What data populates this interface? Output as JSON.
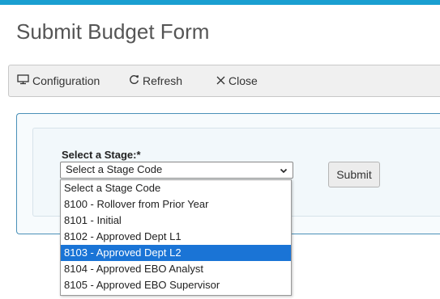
{
  "page": {
    "title": "Submit Budget Form"
  },
  "toolbar": {
    "configuration_label": "Configuration",
    "refresh_label": "Refresh",
    "close_label": "Close"
  },
  "form": {
    "stage_label": "Select a Stage:*",
    "select_value": "Select a Stage Code",
    "submit_label": "Submit"
  },
  "dropdown": {
    "options": [
      "Select a Stage Code",
      "8100 - Rollover from Prior Year",
      "8101 - Initial",
      "8102 - Approved Dept L1",
      "8103 - Approved Dept L2",
      "8104 - Approved EBO Analyst",
      "8105 - Approved EBO Supervisor"
    ],
    "highlighted": "8103 - Approved Dept L2"
  },
  "colors": {
    "accent_bar": "#1a9fd1",
    "panel_border": "#4a90b8",
    "highlight": "#1a74d6"
  },
  "icons": {
    "configuration": "monitor-icon",
    "refresh": "refresh-icon",
    "close": "close-icon",
    "select": "chevron-down-icon"
  }
}
